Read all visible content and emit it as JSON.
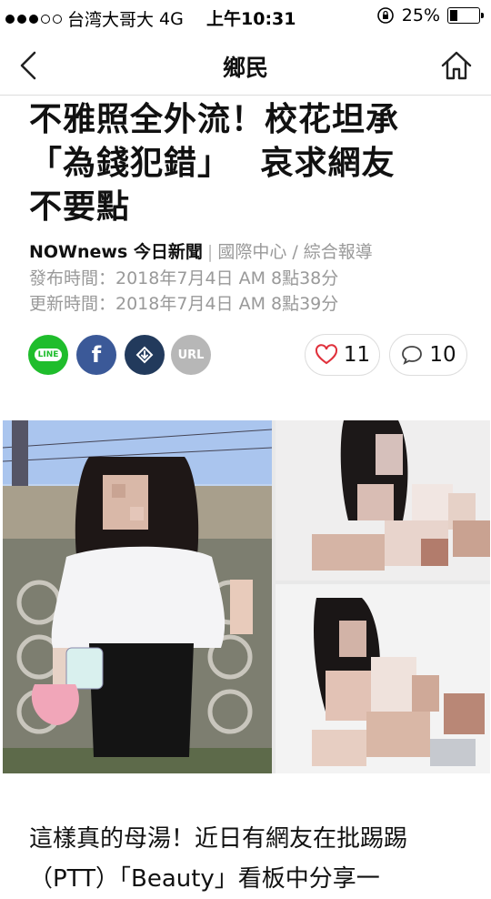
{
  "status": {
    "carrier": "台湾大哥大",
    "network": "4G",
    "time": "上午10:31",
    "battery": "25%",
    "battery_level": 0.25
  },
  "nav": {
    "title": "鄉民",
    "back_icon": "chevron-left-icon",
    "home_icon": "home-icon"
  },
  "article": {
    "headline_lines": [
      "不雅照全外流！校花坦承",
      "「為錢犯錯」　 哀求網友",
      "不要點"
    ],
    "source": "NOWnews 今日新聞",
    "bylines": "國際中心 / 綜合報導",
    "published": "發布時間：2018年7月4日 AM 8點38分",
    "updated": "更新時間：2018年7月4日 AM 8點39分",
    "body_lines": [
      "這樣真的母湯！近日有網友在批踢踢",
      "（PTT）「Beauty」看板中分享一"
    ]
  },
  "share": {
    "line": "LINE",
    "facebook": "f",
    "url": "URL"
  },
  "reactions": {
    "likes": "11",
    "comments": "10"
  },
  "colors": {
    "line": "#1fbd2c",
    "facebook": "#3b5998",
    "dark_share": "#223a5c",
    "url_share": "#b7b7b7",
    "heart": "#e0313c"
  }
}
